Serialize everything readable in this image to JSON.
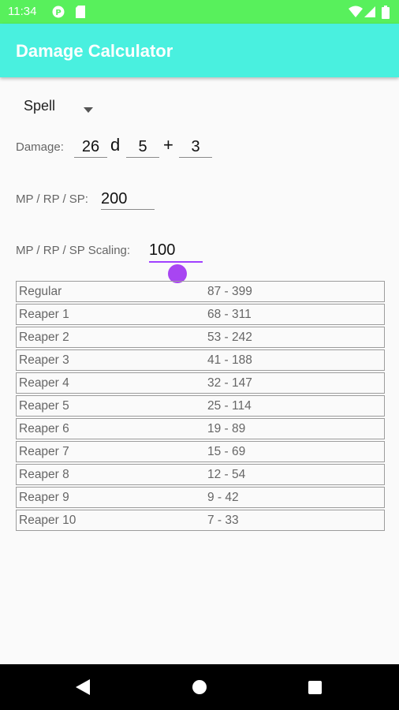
{
  "status_bar": {
    "time": "11:34",
    "icons": [
      "app-notification-icon",
      "sd-card-icon",
      "wifi-icon",
      "signal-icon",
      "battery-icon"
    ],
    "color": "#58f05c"
  },
  "app_bar": {
    "title": "Damage Calculator",
    "color": "#49f0df"
  },
  "form": {
    "type_spinner": {
      "selected": "Spell"
    },
    "damage": {
      "label": "Damage:",
      "dice_count": "26",
      "d_label": "d",
      "dice_sides": "5",
      "plus_label": "+",
      "bonus": "3"
    },
    "mp": {
      "label": "MP / RP / SP:",
      "value": "200"
    },
    "scaling": {
      "label": "MP / RP / SP Scaling:",
      "value": "100"
    }
  },
  "results": [
    {
      "label": "Regular",
      "range": "87 - 399"
    },
    {
      "label": "Reaper 1",
      "range": "68 - 311"
    },
    {
      "label": "Reaper 2",
      "range": "53 - 242"
    },
    {
      "label": "Reaper 3",
      "range": "41 - 188"
    },
    {
      "label": "Reaper 4",
      "range": "32 - 147"
    },
    {
      "label": "Reaper 5",
      "range": "25 - 114"
    },
    {
      "label": "Reaper 6",
      "range": "19 - 89"
    },
    {
      "label": "Reaper 7",
      "range": "15 - 69"
    },
    {
      "label": "Reaper 8",
      "range": "12 - 54"
    },
    {
      "label": "Reaper 9",
      "range": "9 - 42"
    },
    {
      "label": "Reaper 10",
      "range": "7 - 33"
    }
  ],
  "accent_color": "#a845f2",
  "nav_bar": {
    "icons": [
      "back-icon",
      "home-icon",
      "recents-icon"
    ]
  }
}
